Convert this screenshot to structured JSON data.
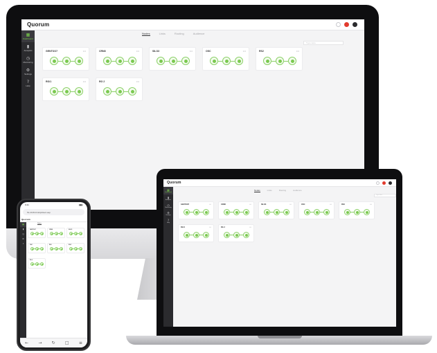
{
  "app": {
    "logo": "Quorum",
    "tabs": [
      {
        "label": "Nodes",
        "active": true
      },
      {
        "label": "Links",
        "active": false
      },
      {
        "label": "Routing",
        "active": false
      },
      {
        "label": "Audience",
        "active": false
      }
    ],
    "sidebar": [
      {
        "label": "Dashboard",
        "icon": "dashboard-icon",
        "glyph": "▦",
        "active": true
      },
      {
        "label": "Analytics",
        "icon": "analytics-icon",
        "glyph": "▮",
        "active": false
      },
      {
        "label": "Monitoring",
        "icon": "monitoring-icon",
        "glyph": "◷",
        "active": false
      },
      {
        "label": "Settings",
        "icon": "gear-icon",
        "glyph": "⚙",
        "active": false
      },
      {
        "label": "Help",
        "icon": "help-icon",
        "glyph": "?",
        "active": false
      }
    ],
    "search_placeholder": "Type Here",
    "cards": [
      {
        "title": "GENTOO7"
      },
      {
        "title": "CRN8"
      },
      {
        "title": "SILO3"
      },
      {
        "title": "OSC"
      },
      {
        "title": "RS2"
      },
      {
        "title": "RG/1"
      },
      {
        "title": "RG 2"
      }
    ]
  },
  "phone": {
    "time": "9:41",
    "url": "51.20.84.0:HttpClient.asp"
  },
  "colors": {
    "accent": "#7bc950",
    "sidebar": "#2b2b2e",
    "notification": "#e23b2e"
  }
}
